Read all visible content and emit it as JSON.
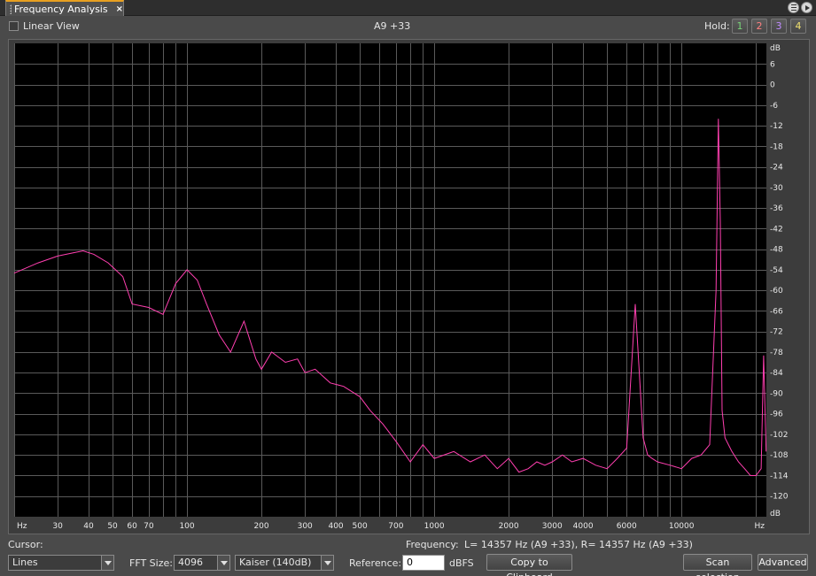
{
  "panel": {
    "tab_title": "Frequency Analysis",
    "tab_close": "×"
  },
  "toolbar": {
    "linear_view_label": "Linear View",
    "linear_view_checked": false,
    "center_note": "A9 +33",
    "hold_label": "Hold:",
    "hold_buttons": [
      "1",
      "2",
      "3",
      "4"
    ]
  },
  "graph": {
    "background": "#000000",
    "grid_color": "#5a5a5a",
    "trace_color": "#ff3fb0",
    "y_unit": "dB",
    "x_unit": "Hz",
    "y_tick_labels": [
      "6",
      "0",
      "-6",
      "-12",
      "-18",
      "-24",
      "-30",
      "-36",
      "-42",
      "-48",
      "-54",
      "-60",
      "-66",
      "-72",
      "-78",
      "-84",
      "-90",
      "-96",
      "-102",
      "-108",
      "-114",
      "-120"
    ],
    "x_tick_labels": [
      {
        "freq": 30,
        "label": "30"
      },
      {
        "freq": 40,
        "label": "40"
      },
      {
        "freq": 50,
        "label": "50"
      },
      {
        "freq": 60,
        "label": "60"
      },
      {
        "freq": 70,
        "label": "70"
      },
      {
        "freq": 100,
        "label": "100"
      },
      {
        "freq": 200,
        "label": "200"
      },
      {
        "freq": 300,
        "label": "300"
      },
      {
        "freq": 400,
        "label": "400"
      },
      {
        "freq": 500,
        "label": "500"
      },
      {
        "freq": 700,
        "label": "700"
      },
      {
        "freq": 1000,
        "label": "1000"
      },
      {
        "freq": 2000,
        "label": "2000"
      },
      {
        "freq": 3000,
        "label": "3000"
      },
      {
        "freq": 4000,
        "label": "4000"
      },
      {
        "freq": 6000,
        "label": "6000"
      },
      {
        "freq": 10000,
        "label": "10000"
      }
    ]
  },
  "chart_data": {
    "type": "line",
    "xscale": "log",
    "xlim": [
      20,
      22050
    ],
    "ylim": [
      -126,
      12
    ],
    "xlabel": "Hz",
    "ylabel": "dB",
    "grid": true,
    "series": [
      {
        "x": [
          20,
          25,
          30,
          35,
          38,
          42,
          48,
          55,
          60,
          70,
          80,
          90,
          100,
          110,
          120,
          135,
          150,
          170,
          190,
          200,
          220,
          250,
          280,
          300,
          330,
          380,
          430,
          500,
          550,
          620,
          700,
          800,
          900,
          1000,
          1200,
          1400,
          1600,
          1800,
          2000,
          2200,
          2400,
          2600,
          2800,
          3000,
          3300,
          3600,
          4000,
          4500,
          5000,
          5500,
          6000,
          6500,
          7000,
          7300,
          7600,
          8000,
          9000,
          10000,
          11000,
          12000,
          13000,
          13800,
          14100,
          14357,
          14600,
          15000,
          16000,
          17000,
          18000,
          19000,
          20000,
          21000,
          21500,
          22000
        ],
        "y": [
          -55,
          -52,
          -50,
          -49,
          -48.5,
          -49.5,
          -52,
          -56,
          -64,
          -65,
          -67,
          -58,
          -54,
          -57,
          -64,
          -73,
          -78,
          -69,
          -80,
          -83,
          -78,
          -81,
          -80,
          -84,
          -83,
          -87,
          -88,
          -91,
          -95,
          -99,
          -104,
          -110,
          -105,
          -109,
          -107,
          -110,
          -108,
          -112,
          -109,
          -113,
          -112,
          -110,
          -111,
          -110,
          -108,
          -110,
          -109,
          -111,
          -112,
          -109,
          -106,
          -64,
          -103,
          -108,
          -109,
          -110,
          -111,
          -112,
          -109,
          -108,
          -105,
          -60,
          -10,
          -40,
          -95,
          -103,
          -107,
          -110,
          -112,
          -114,
          -114,
          -112,
          -79,
          -107
        ]
      }
    ]
  },
  "readout": {
    "cursor_label": "Cursor:",
    "frequency_label": "Frequency:",
    "frequency_value": "L=  14357 Hz (A9 +33), R=  14357 Hz (A9 +33)"
  },
  "controls": {
    "display_mode": "Lines",
    "fft_size_label": "FFT Size:",
    "fft_size": "4096",
    "window": "Kaiser (140dB)",
    "reference_label": "Reference:",
    "reference_value": "0",
    "reference_unit": "dBFS",
    "copy_button": "Copy to Clipboard",
    "scan_button": "Scan selection",
    "advanced_button": "Advanced"
  }
}
